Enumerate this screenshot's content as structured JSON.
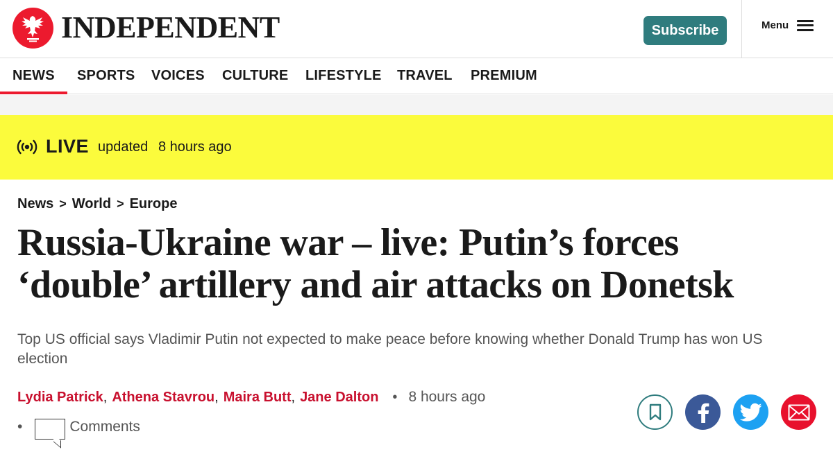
{
  "header": {
    "logo_text": "INDEPENDENT",
    "subscribe_label": "Subscribe",
    "menu_label": "Menu"
  },
  "nav": {
    "items": [
      {
        "label": "NEWS",
        "active": true
      },
      {
        "label": "SPORTS"
      },
      {
        "label": "VOICES"
      },
      {
        "label": "CULTURE"
      },
      {
        "label": "LIFESTYLE"
      },
      {
        "label": "TRAVEL"
      },
      {
        "label": "PREMIUM"
      }
    ]
  },
  "live": {
    "label": "LIVE",
    "updated_label": "updated",
    "time": "8 hours ago"
  },
  "breadcrumb": {
    "items": [
      "News",
      "World",
      "Europe"
    ],
    "separator": ">"
  },
  "article": {
    "headline": "Russia-Ukraine war – live: Putin’s forces ‘double’ artillery and air attacks on Donetsk",
    "standfirst": "Top US official says Vladimir Putin not expected to make peace before knowing whether Donald Trump has won US election",
    "authors": [
      "Lydia Patrick",
      "Athena Stavrou",
      "Maira Butt",
      "Jane Dalton"
    ],
    "time": "8 hours ago",
    "comments_label": "Comments"
  },
  "colors": {
    "brand_red": "#ec1a2e",
    "subscribe_teal": "#2f7c7e",
    "live_yellow": "#fbfb3c",
    "author_red": "#c8102e",
    "facebook_blue": "#3b5998",
    "twitter_blue": "#1da1f2",
    "email_red": "#e8112d"
  },
  "icons": {
    "logo": "eagle-logo-icon",
    "menu": "hamburger-icon",
    "live": "broadcast-icon",
    "bookmark": "bookmark-icon",
    "facebook": "facebook-icon",
    "twitter": "twitter-icon",
    "email": "email-icon",
    "comments": "comment-icon"
  }
}
